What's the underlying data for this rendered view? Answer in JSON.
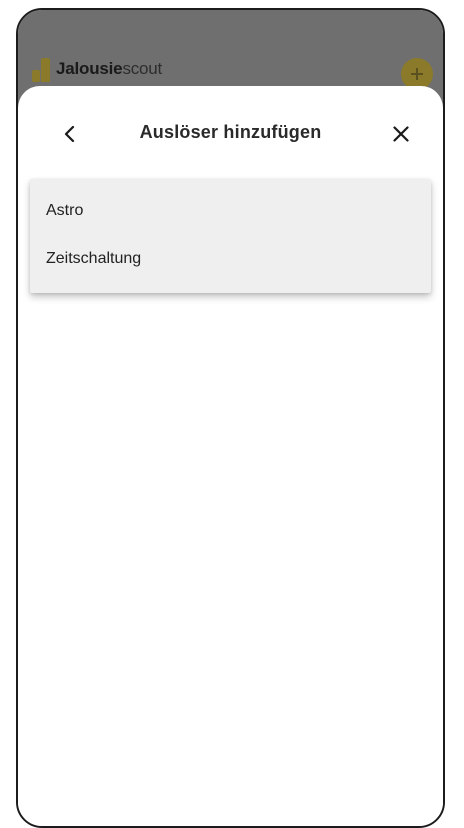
{
  "app": {
    "brand_bold": "Jalousie",
    "brand_light": "scout"
  },
  "sheet": {
    "title": "Auslöser hinzufügen",
    "back_icon": "chevron-left-icon",
    "close_icon": "close-icon"
  },
  "menu": {
    "items": [
      {
        "label": "Astro"
      },
      {
        "label": "Zeitschaltung"
      }
    ]
  },
  "colors": {
    "accent": "#8a7a2a",
    "overlay": "#6f6f6f",
    "menu_background": "#efefef"
  }
}
